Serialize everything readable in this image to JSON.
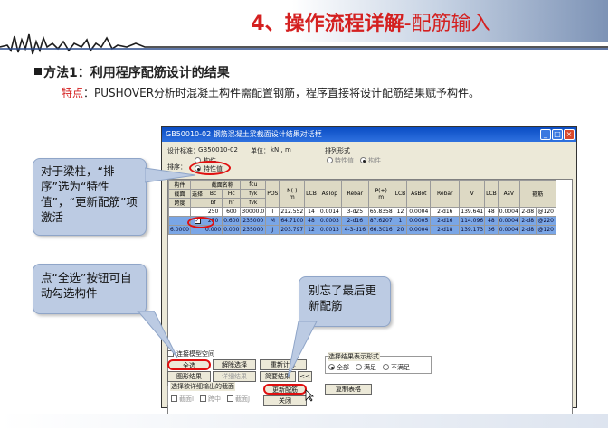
{
  "slide": {
    "title_main": "4、操作流程详解",
    "title_sub": "-配筋输入",
    "method": "方法1：利用程序配筋设计的结果",
    "feature_label": "特点",
    "feature_text": "：PUSHOVER分析时混凝土构件需配置钢筋，程序直接将设计配筋结果赋予构件。"
  },
  "dialog": {
    "title": "GB50010-02 钢筋混凝土梁截面设计结果对话框",
    "standard_label": "设计标准：",
    "standard_value": "GB50010-02",
    "unit_label": "单位：",
    "unit_value": "kN  ,  m",
    "sort_group": "排列形式",
    "sort_opt_a": "特性值",
    "sort_opt_b": "构件",
    "order_label": "排序：",
    "order_opt_a": "构件",
    "order_opt_b": "特性值",
    "headers1": [
      "构件",
      "",
      "截面名称",
      "fcu",
      "",
      "",
      "",
      "",
      "",
      "",
      "",
      "",
      "",
      "",
      "",
      "",
      "",
      "",
      ""
    ],
    "headers": {
      "member": "构件",
      "section_name": "截面名称",
      "fcu": "fcu",
      "section": "截面",
      "select": "选择",
      "bc": "Bc",
      "hc": "Hc",
      "fyk": "fyk",
      "pos": "POS",
      "n": "N(-)\nm",
      "lcb": "LCB",
      "astop": "AsTop",
      "rebar": "Rebar",
      "p": "P(+)\nm",
      "lcb2": "LCB",
      "asbot": "AsBot",
      "rebar2": "Rebar",
      "v": "V",
      "lcb3": "LCB",
      "asv": "AsV",
      "stirrup": "箍筋",
      "span": "跨度",
      "bf": "bf",
      "hf": "hf",
      "fvk": "fvk"
    },
    "rows": [
      [
        "",
        "",
        "250",
        "600",
        "30000.0",
        "I",
        "212.552",
        "14",
        "0.0014",
        "3-d25",
        "65.8358",
        "12",
        "0.0004",
        "2-d16",
        "139.641",
        "48",
        "0.0004",
        "2-d8",
        "@120"
      ],
      [
        "",
        "",
        "250",
        "0.600",
        "235000",
        "M",
        "64.7100",
        "48",
        "0.0003",
        "2-d16",
        "87.6207",
        "1",
        "0.0005",
        "2-d16",
        "114.096",
        "48",
        "0.0004",
        "2-d8",
        "@220"
      ],
      [
        "6.0000",
        "",
        "0.000",
        "0.000",
        "235000",
        "J",
        "203.797",
        "12",
        "0.0013",
        "4-3-d16",
        "66.3016",
        "20",
        "0.0004",
        "2-d18",
        "139.173",
        "36",
        "0.0004",
        "2-d8",
        "@120"
      ]
    ],
    "connect_label": "连接模型空间",
    "btn_select_all": "全选",
    "btn_deselect": "解除选择",
    "btn_recalc": "重新计算",
    "btn_graph": "图形结果",
    "btn_detail": "详细结果",
    "btn_brief": "简要结果",
    "btn_more": "<<",
    "btn_update": "更新配筋",
    "btn_close": "关闭",
    "btn_copy": "复制表格",
    "output_group": "选择欲详细输出的截面",
    "output_opts": [
      "截面I",
      "跨中",
      "截面J"
    ],
    "display_group": "选择结果表示形式",
    "display_opts": [
      "全部",
      "满足",
      "不满足"
    ]
  },
  "callouts": {
    "sort": "对于梁柱，“排序”选为“特性值”，“更新配筋”项激活",
    "select_all": "点“全选”按钮可自动勾选构件",
    "update": "别忘了最后更新配筋"
  }
}
